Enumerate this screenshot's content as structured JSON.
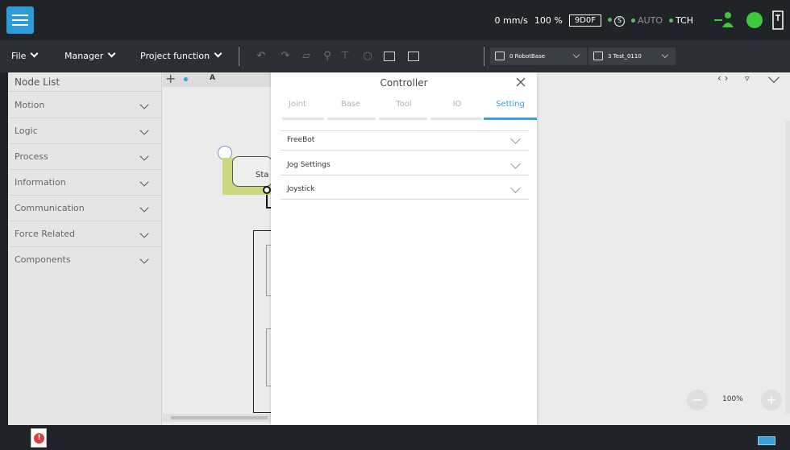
{
  "topbar": {
    "speed": "0 mm/s",
    "override": "100 %",
    "dof": "9D0F",
    "mode_auto": "AUTO",
    "mode_tch": "TCH"
  },
  "toolbar": {
    "file": "File",
    "manager": "Manager",
    "project_function": "Project function",
    "base_select": "0 RobotBase",
    "tool_select": "3 Test_0110"
  },
  "nodelist": {
    "title": "Node List",
    "items": [
      {
        "label": "Motion"
      },
      {
        "label": "Logic"
      },
      {
        "label": "Process"
      },
      {
        "label": "Information"
      },
      {
        "label": "Communication"
      },
      {
        "label": "Force Related"
      },
      {
        "label": "Components"
      }
    ]
  },
  "canvas": {
    "tab_label": "A",
    "start_node": "Sta",
    "zoom": "100%"
  },
  "controller": {
    "title": "Controller",
    "tabs": [
      {
        "label": "Joint"
      },
      {
        "label": "Base"
      },
      {
        "label": "Tool"
      },
      {
        "label": "IO"
      },
      {
        "label": "Setting"
      }
    ],
    "active_tab": "Setting",
    "sections": [
      {
        "label": "FreeBot"
      },
      {
        "label": "Jog Settings"
      },
      {
        "label": "Joystick"
      }
    ]
  },
  "colors": {
    "accent": "#3aa0d8",
    "status_green": "#3ec93e",
    "alarm_red": "#e23b3b"
  }
}
